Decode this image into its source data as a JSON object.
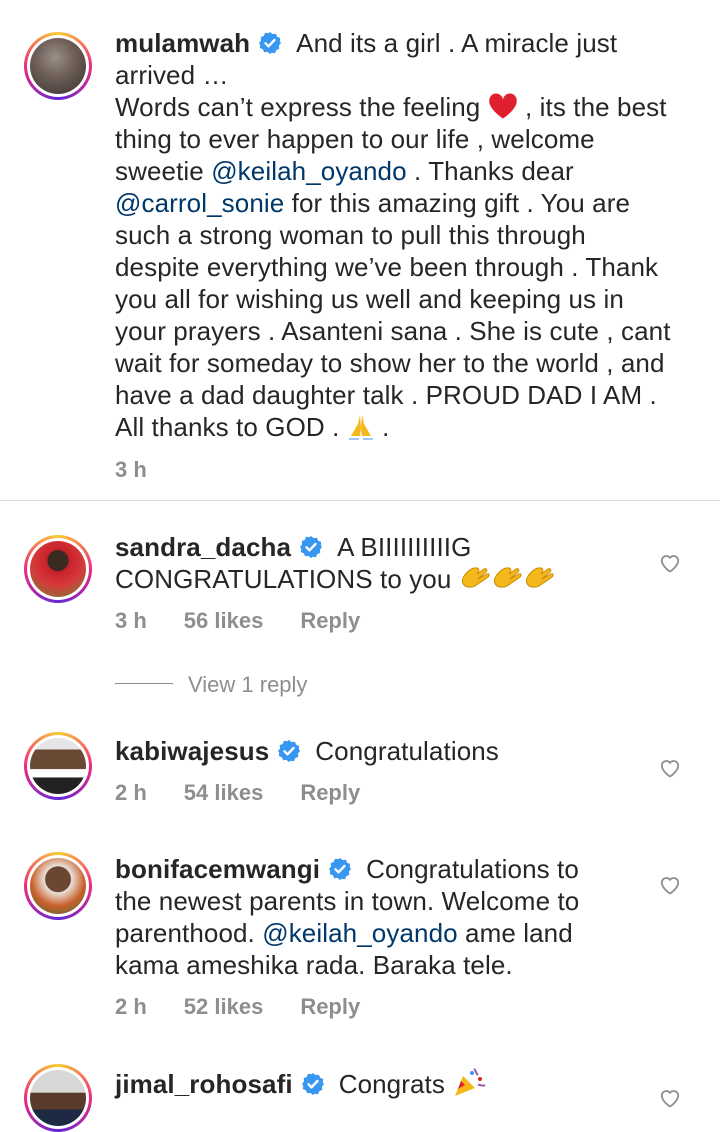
{
  "comments": [
    {
      "username": "mulamwah",
      "text_parts": {
        "p1": "And its a girl . A miracle just arrived …",
        "p2": "Words can’t express the feeling ",
        "p3": " , its the best thing to ever happen to our life , welcome sweetie ",
        "m1": "@keilah_oyando",
        "p4": " . Thanks dear ",
        "m2": "@carrol_sonie",
        "p5": " for this amazing gift . You are such a strong woman to pull this through despite everything we’ve been through . Thank you all for wishing us well and keeping us in your prayers . Asanteni sana . She is cute , cant wait for someday to show her to the world , and have a dad daughter talk . PROUD DAD I AM . All thanks to GOD . ",
        "p6": " ."
      },
      "time": "3 h"
    },
    {
      "username": "sandra_dacha",
      "text": "A BIIIIIIIIIIG CONGRATULATIONS to you ",
      "time": "3 h",
      "likes": "56 likes",
      "reply": "Reply",
      "view_replies": "View 1 reply"
    },
    {
      "username": "kabiwajesus",
      "text": "Congratulations",
      "time": "2 h",
      "likes": "54 likes",
      "reply": "Reply"
    },
    {
      "username": "bonifacemwangi",
      "text_a": "Congratulations to the newest parents in town. Welcome to parenthood. ",
      "mention": "@keilah_oyando",
      "text_b": " ame land kama ameshika rada. Baraka tele.",
      "time": "2 h",
      "likes": "52 likes",
      "reply": "Reply"
    },
    {
      "username": "jimal_rohosafi",
      "text": "Congrats "
    }
  ],
  "colors": {
    "verified_blue": "#3897f0",
    "mention": "#00376b",
    "meta_gray": "#8e8e8e"
  },
  "icons": [
    "verified-badge-icon",
    "heart-outline-icon",
    "red-heart-emoji",
    "praying-hands-emoji",
    "clapping-hands-emoji",
    "party-popper-emoji"
  ]
}
